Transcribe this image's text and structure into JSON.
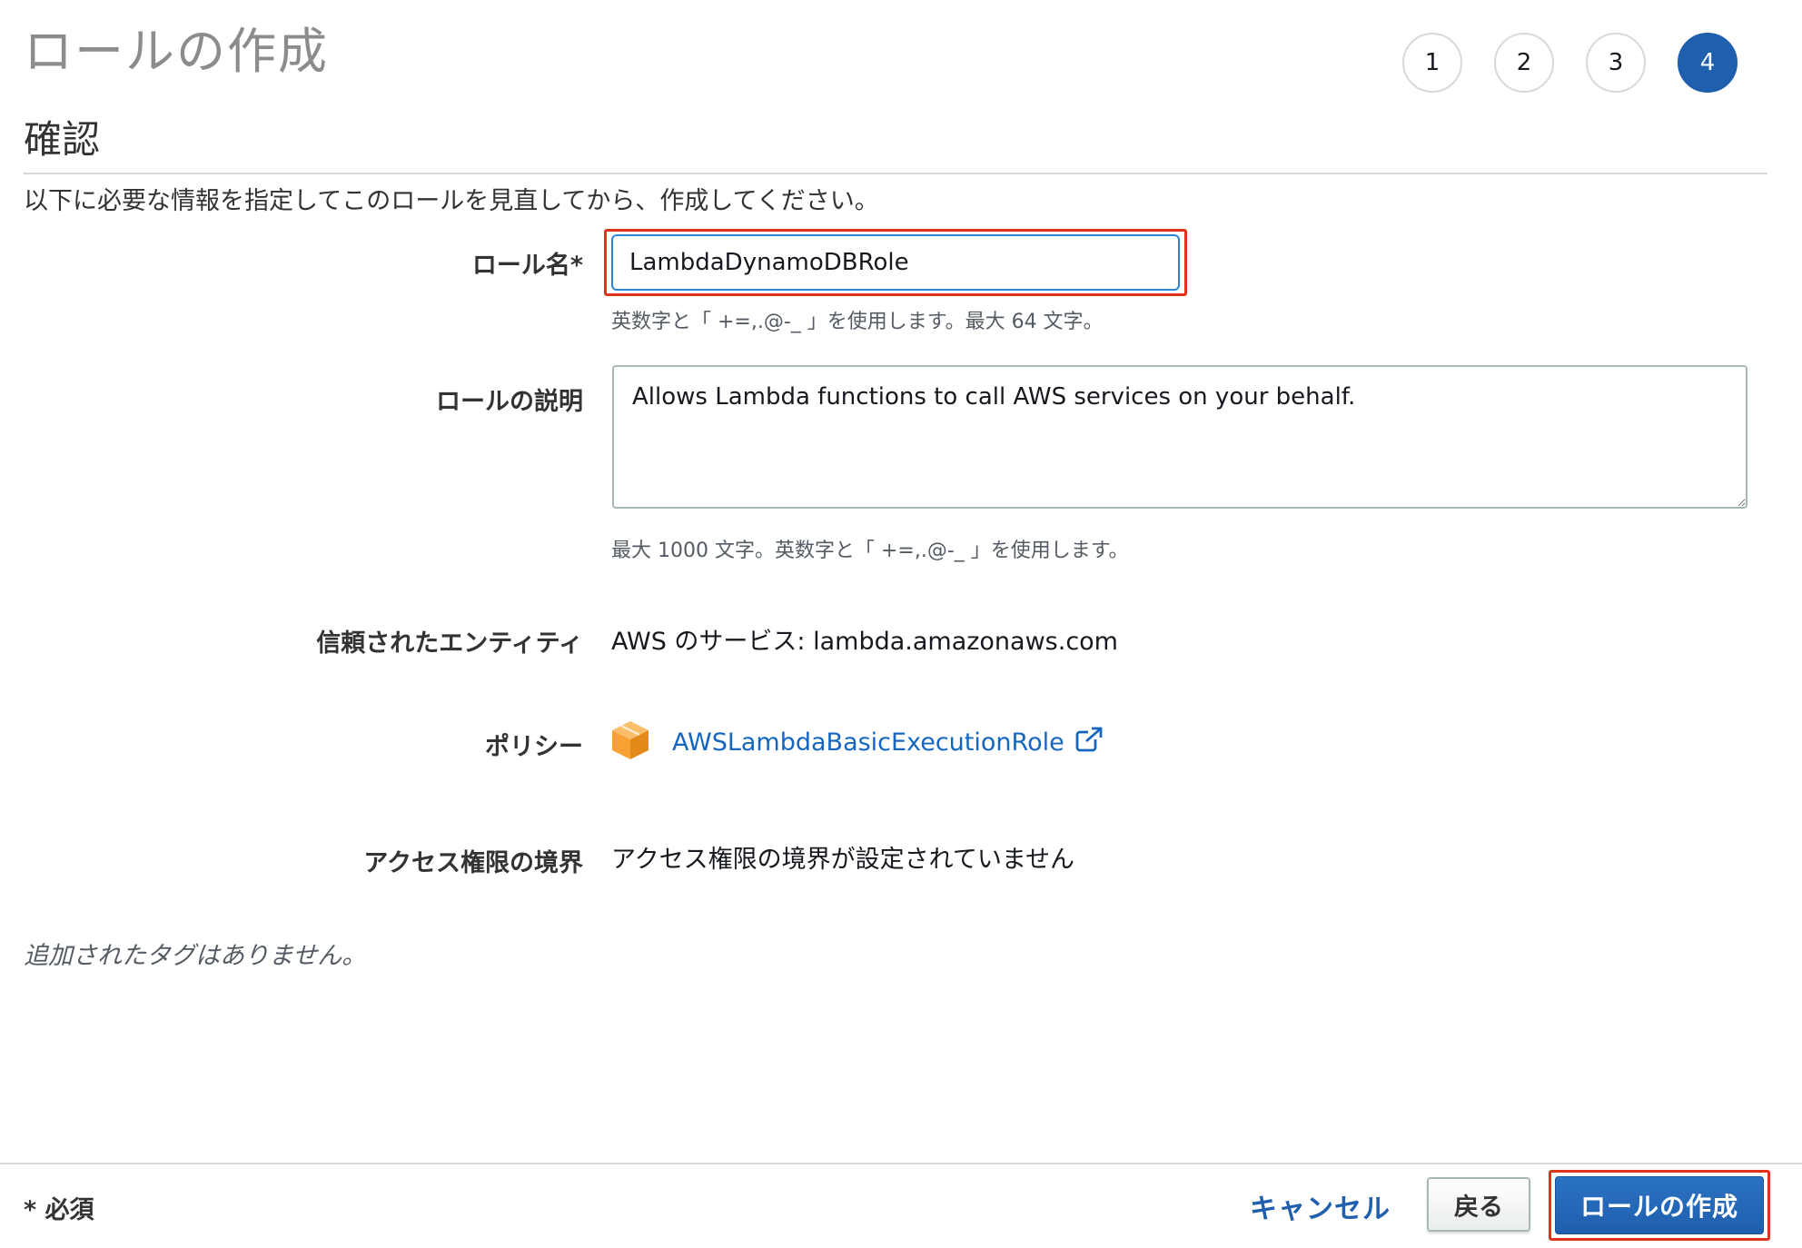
{
  "header": {
    "title": "ロールの作成",
    "steps": [
      "1",
      "2",
      "3",
      "4"
    ],
    "active_step": "4"
  },
  "section": {
    "title": "確認",
    "intro": "以下に必要な情報を指定してこのロールを見直してから、作成してください。"
  },
  "form": {
    "role_name": {
      "label": "ロール名",
      "required_mark": "*",
      "value": "LambdaDynamoDBRole",
      "hint": "英数字と「 +=,.@-_ 」を使用します。最大 64 文字。"
    },
    "description": {
      "label": "ロールの説明",
      "value": "Allows Lambda functions to call AWS services on your behalf.",
      "hint": "最大 1000 文字。英数字と「 +=,.@-_ 」を使用します。"
    },
    "trusted_entity": {
      "label": "信頼されたエンティティ",
      "value": "AWS のサービス: lambda.amazonaws.com"
    },
    "policy": {
      "label": "ポリシー",
      "icon": "cube-icon",
      "link_text": "AWSLambdaBasicExecutionRole",
      "link_icon": "external-link-icon"
    },
    "permissions_boundary": {
      "label": "アクセス権限の境界",
      "value": "アクセス権限の境界が設定されていません"
    }
  },
  "tags": {
    "empty_text": "追加されたタグはありません。"
  },
  "footer": {
    "required_note": "* 必須",
    "cancel_label": "キャンセル",
    "back_label": "戻る",
    "create_label": "ロールの作成"
  },
  "colors": {
    "accent": "#1f5fad",
    "highlight": "#e0331b",
    "policy_icon": "#f7a034"
  }
}
